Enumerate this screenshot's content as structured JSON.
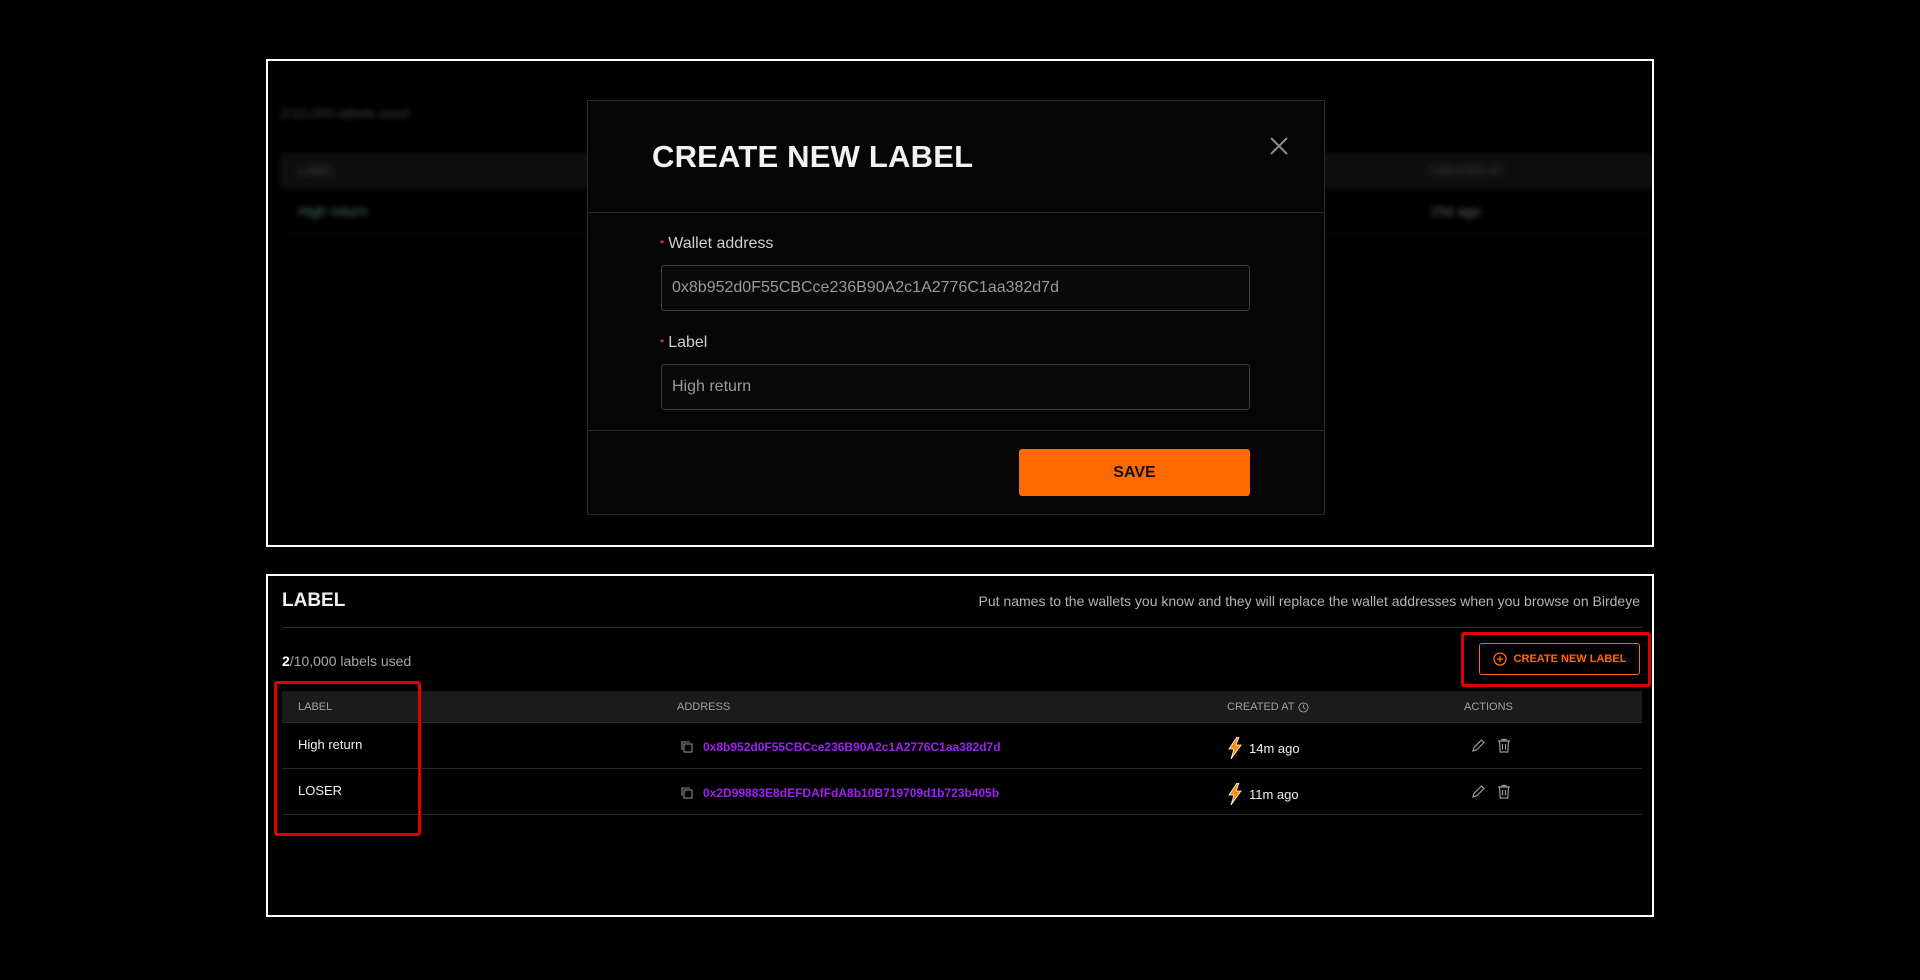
{
  "modal": {
    "title": "CREATE NEW LABEL",
    "fields": [
      {
        "label": "Wallet address",
        "value": "0x8b952d0F55CBCce236B90A2c1A2776C1aa382d7d"
      },
      {
        "label": "Label",
        "value": "High return"
      }
    ],
    "save_label": "SAVE"
  },
  "background": {
    "usage": "2/10,000 labels used",
    "col_label": "LABEL",
    "col_created": "CREATED AT",
    "row_label": "High return",
    "row_created": "15d ago"
  },
  "section": {
    "title": "LABEL",
    "description": "Put names to the wallets you know and they will replace the wallet addresses when you browse on Birdeye",
    "used_count": "2",
    "used_total": "/10,000 labels used",
    "create_label": "CREATE NEW LABEL"
  },
  "table": {
    "headers": [
      "LABEL",
      "ADDRESS",
      "CREATED AT",
      "ACTIONS"
    ],
    "rows": [
      {
        "label": "High return",
        "address": "0x8b952d0F55CBCce236B90A2c1A2776C1aa382d7d",
        "created": "14m ago"
      },
      {
        "label": "LOSER",
        "address": "0x2D99883E8dEFDAfFdA8b10B719709d1b723b405b",
        "created": "11m ago"
      }
    ]
  },
  "colors": {
    "accent": "#ff6a00",
    "address": "#a020f0",
    "highlight": "#e00000"
  },
  "icons": [
    "close-icon",
    "add-circle-icon",
    "copy-icon",
    "lightning-icon",
    "edit-icon",
    "trash-icon",
    "clock-icon"
  ]
}
